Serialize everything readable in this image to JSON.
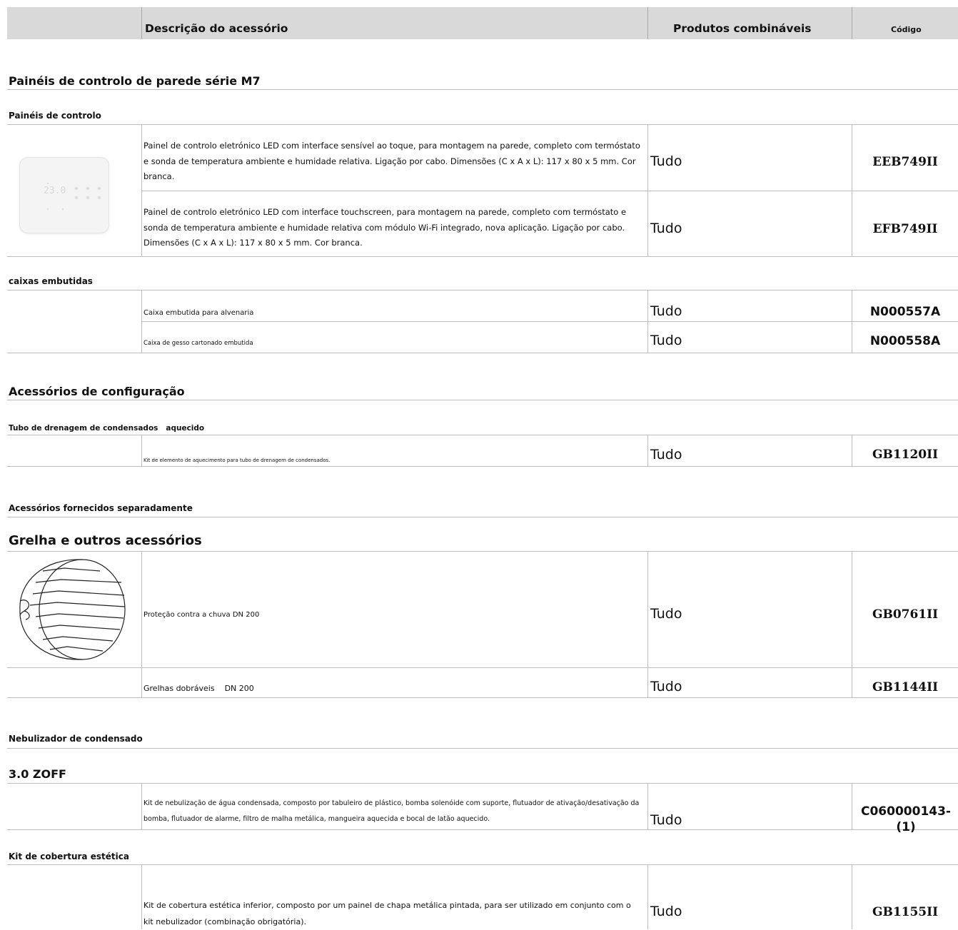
{
  "header": {
    "description": "Descrição do acessório",
    "products": "Produtos combináveis",
    "code": "Código"
  },
  "sections": {
    "m7_panels": "Painéis de controlo de parede série M7",
    "control_panels": "Painéis de controlo",
    "flush_boxes": "caixas embutidas",
    "config_accessories": "Acessórios de configuração",
    "heated_drain": "Tubo de drenagem de condensados   aquecido",
    "separate_accessories": "Acessórios fornecidos separadamente",
    "grille_other": "Grelha e outros acessórios",
    "nebulizer": "Nebulizador de condensado",
    "zoff": "3.0 ZOFF",
    "aesthetic_cover": "Kit de cobertura estética"
  },
  "thermostat_display": "23.0",
  "rows": [
    {
      "description": "Painel de controlo eletrónico LED com interface sensível ao toque, para montagem na parede, completo com termóstato e sonda de temperatura ambiente e humidade relativa. Ligação por cabo. Dimensões (C x A x L): 117 x 80 x 5 mm. Cor branca.",
      "products": "Tudo",
      "code": "EEB749II"
    },
    {
      "description": "Painel de controlo eletrónico LED com interface touchscreen, para montagem na parede, completo com termóstato e sonda de temperatura ambiente e humidade relativa com módulo Wi-Fi integrado, nova aplicação. Ligação por cabo. Dimensões (C x A x L): 117 x 80 x 5 mm. Cor branca.",
      "products": "Tudo",
      "code": "EFB749II"
    },
    {
      "description": "Caixa embutida para alvenaria",
      "products": "Tudo",
      "code": "N000557A"
    },
    {
      "description": "Caixa de gesso cartonado embutida",
      "products": "Tudo",
      "code": "N000558A"
    },
    {
      "description": "Kit de elemento de aquecimento para tubo de drenagem de condensados.",
      "products": "Tudo",
      "code": "GB1120II"
    },
    {
      "description": "Proteção contra a chuva DN 200",
      "products": "Tudo",
      "code": "GB0761II"
    },
    {
      "description": "Grelhas dobráveis    DN 200",
      "products": "Tudo",
      "code": "GB1144II"
    },
    {
      "description": "Kit de nebulização de água condensada, composto por tabuleiro de plástico, bomba solenóide com suporte, flutuador de ativação/desativação da bomba, flutuador de alarme, filtro de malha metálica, mangueira aquecida e bocal de latão aquecido.",
      "products": "Tudo",
      "code": "C060000143-(1)"
    },
    {
      "description": "Kit de cobertura estética inferior, composto por um painel de chapa metálica pintada, para ser utilizado em conjunto com o kit nebulizador (combinação obrigatória).",
      "products": "Tudo",
      "code": "GB1155II"
    }
  ]
}
